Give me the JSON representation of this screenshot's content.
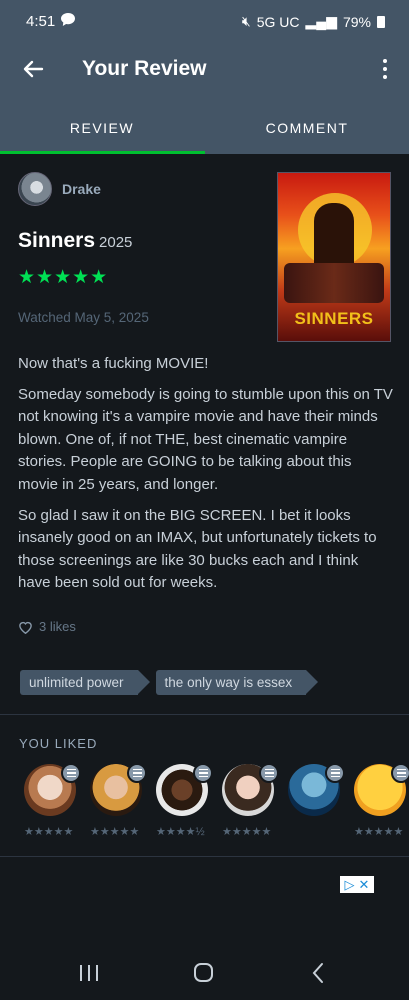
{
  "status_bar": {
    "time": "4:51",
    "network": "5G UC",
    "battery": "79%"
  },
  "header": {
    "title": "Your Review"
  },
  "tabs": [
    {
      "label": "REVIEW"
    },
    {
      "label": "COMMENT"
    }
  ],
  "review": {
    "reviewer": "Drake",
    "film_title": "Sinners",
    "film_year": "2025",
    "rating": "★★★★★",
    "watched": "Watched May 5, 2025",
    "poster_title": "SINNERS",
    "paragraphs": [
      "Now that's a fucking MOVIE!",
      "Someday somebody is going to stumble upon this on TV not knowing it's a vampire movie and have their minds blown. One of, if not THE, best cinematic vampire stories. People are GOING to be talking about this movie in 25 years, and longer.",
      "So glad I saw it on the BIG SCREEN. I bet it looks insanely good on an IMAX, but unfortunately tickets to those screenings are like 30 bucks each and I think have been sold out for weeks."
    ],
    "likes": "3 likes",
    "tags": [
      "unlimited power",
      "the only way is essex"
    ]
  },
  "you_liked": {
    "heading": "YOU LIKED",
    "users": [
      {
        "rating": "★★★★★"
      },
      {
        "rating": "★★★★★"
      },
      {
        "rating": "★★★★½"
      },
      {
        "rating": "★★★★★"
      },
      {
        "rating": ""
      },
      {
        "rating": "★★★★★"
      }
    ]
  },
  "colors": {
    "accent": "#00e054",
    "header": "#445566",
    "background": "#14181c"
  }
}
